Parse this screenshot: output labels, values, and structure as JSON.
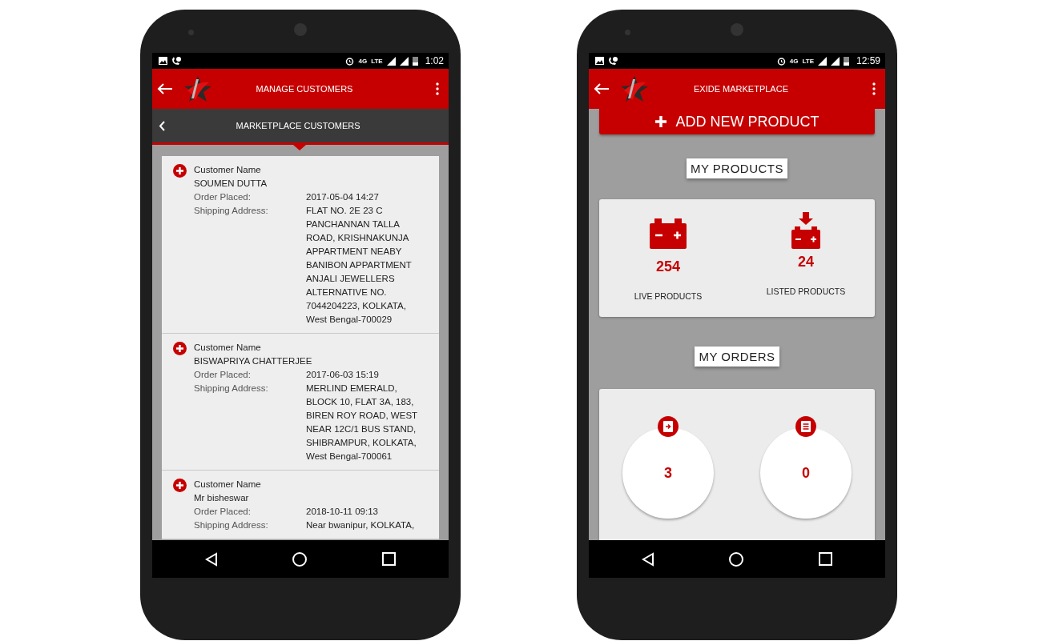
{
  "phones": [
    {
      "kind": "customers",
      "status_bar": {
        "network": [
          "4G",
          "LTE"
        ],
        "time": "1:02"
      },
      "app_bar": {
        "title": "MANAGE CUSTOMERS"
      },
      "sub_bar": {
        "title": "MARKETPLACE CUSTOMERS"
      },
      "customers": [
        {
          "name_label": "Customer Name",
          "name": "SOUMEN DUTTA",
          "fields": [
            {
              "label": "Order Placed:",
              "lines": [
                "2017-05-04 14:27"
              ]
            },
            {
              "label": "Shipping Address:",
              "lines": [
                "FLAT NO. 2E 23 C",
                "PANCHANNAN TALLA",
                "ROAD, KRISHNAKUNJA",
                "APPARTMENT NEABY",
                "BANIBON APPARTMENT",
                "ANJALI JEWELLERS",
                "ALTERNATIVE NO.",
                "7044204223, KOLKATA,",
                "West Bengal-700029"
              ]
            }
          ]
        },
        {
          "name_label": "Customer Name",
          "name": "BISWAPRIYA CHATTERJEE",
          "fields": [
            {
              "label": "Order Placed:",
              "lines": [
                "2017-06-03 15:19"
              ]
            },
            {
              "label": "Shipping Address:",
              "lines": [
                "MERLIND EMERALD,",
                "BLOCK 10, FLAT 3A, 183,",
                "BIREN ROY ROAD, WEST",
                "NEAR 12C/1 BUS STAND,",
                "SHIBRAMPUR, KOLKATA,",
                "West Bengal-700061"
              ]
            }
          ]
        },
        {
          "name_label": "Customer Name",
          "name": "Mr bisheswar",
          "fields": [
            {
              "label": "Order Placed:",
              "lines": [
                "2018-10-11 09:13"
              ]
            },
            {
              "label": "Shipping Address:",
              "lines": [
                "Near bwanipur, KOLKATA,"
              ]
            }
          ]
        }
      ]
    },
    {
      "kind": "marketplace",
      "status_bar": {
        "network": [
          "4G",
          "LTE"
        ],
        "time": "12:59"
      },
      "app_bar": {
        "title": "EXIDE MARKETPLACE"
      },
      "add_button": {
        "label": "ADD NEW PRODUCT"
      },
      "products": {
        "heading": "MY PRODUCTS",
        "stats": [
          {
            "kind": "live",
            "value": "254",
            "label": "LIVE PRODUCTS"
          },
          {
            "kind": "listed",
            "value": "24",
            "label": "LISTED PRODUCTS"
          }
        ]
      },
      "orders": {
        "heading": "MY ORDERS",
        "stats": [
          {
            "kind": "accepted",
            "value": "3"
          },
          {
            "kind": "dispatched",
            "value": "0"
          }
        ]
      }
    }
  ]
}
